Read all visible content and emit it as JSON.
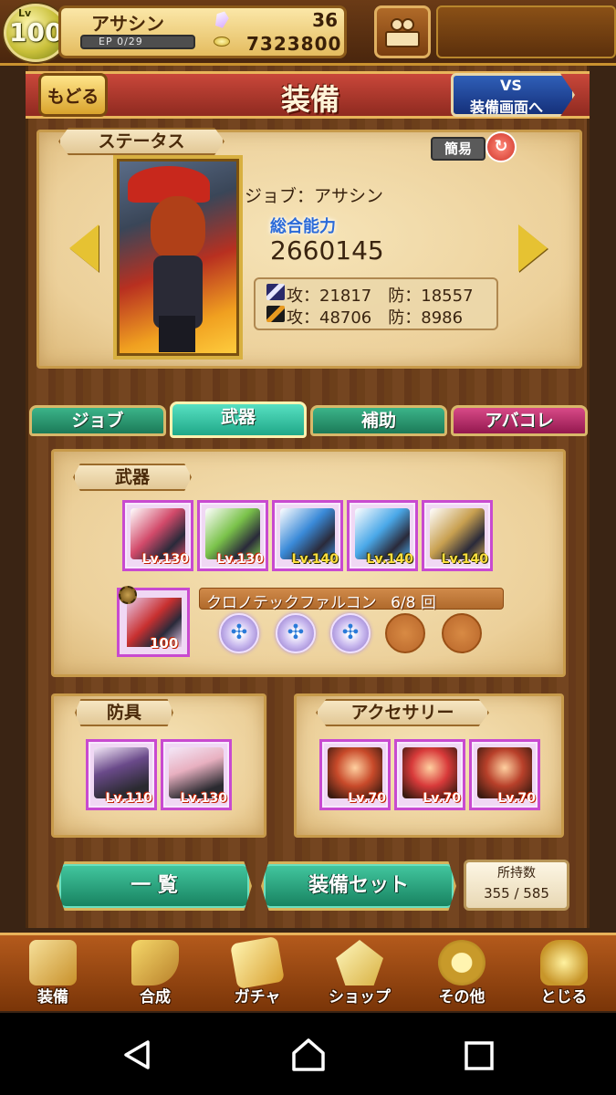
{
  "header": {
    "level_prefix": "Lv",
    "level": "100",
    "player_name": "アサシン",
    "ep_label": "EP 0/29",
    "ep_fraction": 0,
    "crystal_count": "36",
    "gold_count": "7323800"
  },
  "titlebar": {
    "back_label": "もどる",
    "title": "装備",
    "vs_line1": "VS",
    "vs_line2": "装備画面へ"
  },
  "status": {
    "section_title": "ステータス",
    "simple_toggle": "簡易",
    "job": "ジョブ：アサシン",
    "power_label": "総合能力",
    "power_value": "2660145",
    "stat_row1": "攻：21817　防：18557",
    "stat_row2": "攻：48706　防：8986"
  },
  "tabs": [
    {
      "label": "ジョブ"
    },
    {
      "label": "武器"
    },
    {
      "label": "補助"
    },
    {
      "label": "アバコレ"
    }
  ],
  "weapons": {
    "section_title": "武器",
    "items": [
      {
        "lv": "Lv.130",
        "color": "#d24a6a"
      },
      {
        "lv": "Lv.130",
        "color": "#7ac24a"
      },
      {
        "lv": "Lv.140",
        "color": "#3a8ad8"
      },
      {
        "lv": "Lv.140",
        "color": "#4aa8e8"
      },
      {
        "lv": "Lv.140",
        "color": "#c8a050"
      }
    ],
    "selected": {
      "lv": "100"
    },
    "selected_name": "クロノテックファルコン",
    "uses": "6/8 回",
    "slots": [
      true,
      true,
      true,
      false,
      false
    ]
  },
  "armor": {
    "section_title": "防具",
    "items": [
      {
        "lv": "Lv.110",
        "color": "#6a4a8a"
      },
      {
        "lv": "Lv.130",
        "color": "#e8b0c0"
      }
    ]
  },
  "accessory": {
    "section_title": "アクセサリー",
    "items": [
      {
        "lv": "Lv.70",
        "color": "#c84a2a"
      },
      {
        "lv": "Lv.70",
        "color": "#d83a3a"
      },
      {
        "lv": "Lv.70",
        "color": "#b8402a"
      }
    ]
  },
  "actions": {
    "list_label": "一 覧",
    "set_label": "装備セット",
    "count_label": "所持数",
    "count_value": "355 / 585"
  },
  "bottom_nav": [
    {
      "label": "装備",
      "icon": "equip-icon"
    },
    {
      "label": "合成",
      "icon": "hammer-icon"
    },
    {
      "label": "ガチャ",
      "icon": "gacha-icon"
    },
    {
      "label": "ショップ",
      "icon": "shop-icon"
    },
    {
      "label": "その他",
      "icon": "gear-icon"
    },
    {
      "label": "とじる",
      "icon": "close-icon"
    }
  ]
}
